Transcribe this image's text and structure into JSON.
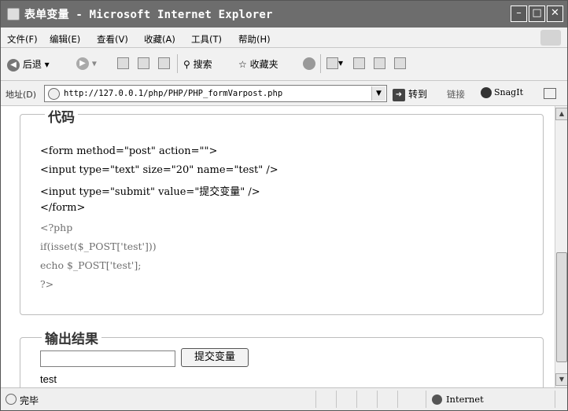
{
  "window": {
    "title": "表单变量 - Microsoft Internet Explorer",
    "minimize_label": "–",
    "maximize_label": "□",
    "close_label": "✕"
  },
  "menu": {
    "items": [
      "文件(F)",
      "编辑(E)",
      "查看(V)",
      "收藏(A)",
      "工具(T)",
      "帮助(H)"
    ]
  },
  "toolbar": {
    "back": "后退",
    "search": "搜索",
    "favorites": "收藏夹"
  },
  "address": {
    "label": "地址(D)",
    "url": "http://127.0.0.1/php/PHP/PHP_formVarpost.php",
    "go": "转到",
    "links": "链接",
    "snagit": "SnagIt"
  },
  "content": {
    "code_legend": "代码",
    "code_lines": [
      "<form method=\"post\" action=\"\">",
      "<input type=\"text\" size=\"20\" name=\"test\" />",
      "<input type=\"submit\" value=\"提交变量\" />",
      "</form>",
      "<?php",
      "if(isset($_POST['test']))",
      "echo $_POST['test'];",
      "?>"
    ],
    "output_legend": "输出结果",
    "input_value": "",
    "submit_label": "提交变量",
    "output_text": "test"
  },
  "status": {
    "text": "完毕",
    "zone": "Internet"
  }
}
